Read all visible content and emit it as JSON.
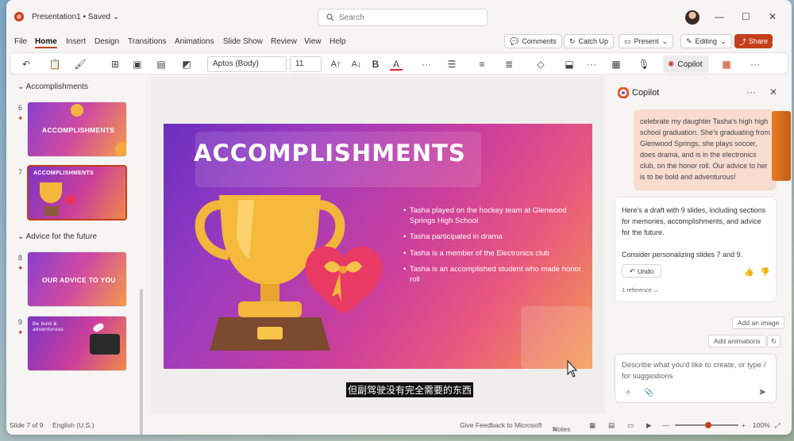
{
  "titlebar": {
    "doc": "Presentation1 • Saved ⌄",
    "search_placeholder": "Search"
  },
  "menu": [
    "File",
    "Home",
    "Insert",
    "Design",
    "Transitions",
    "Animations",
    "Slide Show",
    "Review",
    "View",
    "Help"
  ],
  "actions": {
    "comments": "Comments",
    "catchup": "Catch Up",
    "present": "Present",
    "editing": "Editing",
    "share": "Share"
  },
  "ribbon": {
    "font": "Aptos (Body)",
    "size": "11",
    "copilot": "Copilot"
  },
  "slides_panel": {
    "sections": [
      "Accomplishments",
      "Advice for the future"
    ],
    "thumbs": [
      {
        "num": "6",
        "label": "ACCOMPLISHMENTS"
      },
      {
        "num": "7",
        "label": "ACCOMPLISHMENTS"
      },
      {
        "num": "8",
        "label": "OUR ADVICE TO YOU"
      },
      {
        "num": "9",
        "label": "Be bold & adventurous"
      }
    ]
  },
  "slide": {
    "title": "ACCOMPLISHMENTS",
    "bullets": [
      "Tasha played on the hockey team at Glenwood Springs High School",
      "Tasha participated in drama",
      "Tasha is a member of the Electronics club",
      "Tasha is an accomplished student who made honor roll"
    ]
  },
  "subtitle": "但副驾驶没有完全需要的东西",
  "copilot": {
    "title": "Copilot",
    "user_msg": "celebrate my daughter Tasha's high high school graduation. She's graduating from Glenwood Springs, she plays soccer, does drama, and is in the electronics club, on the honor roll. Our advice to her is to be bold and adventurous!",
    "ai_msg_1": "Here's a draft with 9 slides, including sections for memories, accomplishments, and advice for the future.",
    "ai_msg_2": "Consider personalizing slides 7 and 9.",
    "undo": "Undo",
    "reference": "1 reference",
    "add_image": "Add an image",
    "add_animations": "Add animations",
    "input_placeholder": "Describe what you'd like to create, or type / for suggestions"
  },
  "status": {
    "slide": "Slide 7 of 9",
    "lang": "English (U.S.)",
    "feedback": "Give Feedback to Microsoft",
    "notes": "Notes",
    "zoom": "100%"
  }
}
